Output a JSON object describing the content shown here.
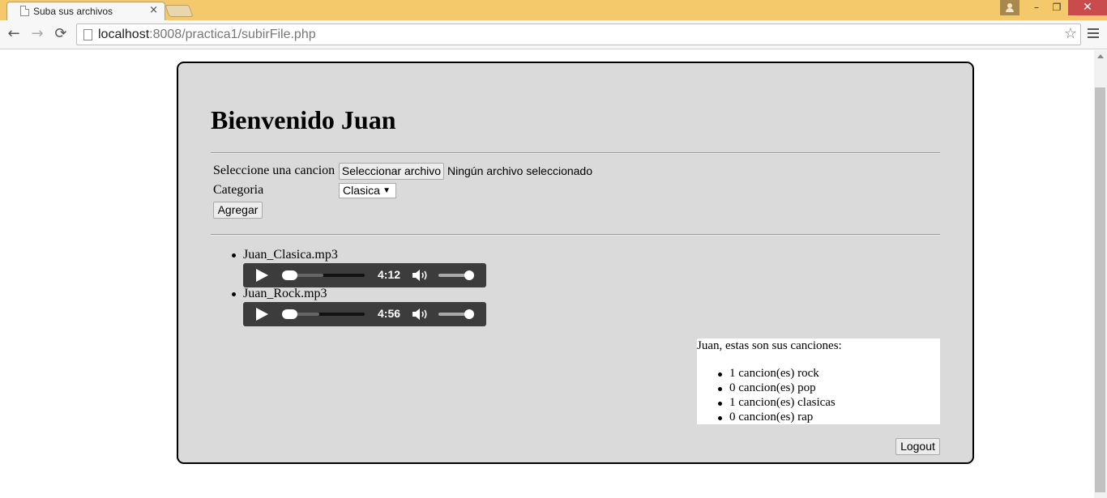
{
  "browser": {
    "tab_title": "Suba sus archivos",
    "tab_close": "×",
    "url_host": "localhost",
    "url_rest": ":8008/practica1/subirFile.php",
    "win_min": "–",
    "win_max": "❐",
    "win_close": "✕",
    "nav_back": "←",
    "nav_forward": "→",
    "nav_reload": "⟳",
    "star": "☆"
  },
  "page": {
    "welcome": "Bienvenido Juan",
    "form": {
      "song_label": "Seleccione una cancion",
      "file_button": "Seleccionar archivo",
      "file_status": "Ningún archivo seleccionado",
      "category_label": "Categoria",
      "category_value": "Clasica",
      "add_button": "Agregar"
    },
    "songs": [
      {
        "name": "Juan_Clasica.mp3",
        "duration": "4:12",
        "buffered_fraction": 0.5,
        "position_fraction": 0.0,
        "volume_fraction": 1.0
      },
      {
        "name": "Juan_Rock.mp3",
        "duration": "4:56",
        "buffered_fraction": 0.45,
        "position_fraction": 0.0,
        "volume_fraction": 1.0
      }
    ],
    "summary": {
      "intro": "Juan, estas son sus canciones:",
      "items": [
        "1 cancion(es) rock",
        "0 cancion(es) pop",
        "1 cancion(es) clasicas",
        "0 cancion(es) rap"
      ]
    },
    "logout_button": "Logout"
  }
}
